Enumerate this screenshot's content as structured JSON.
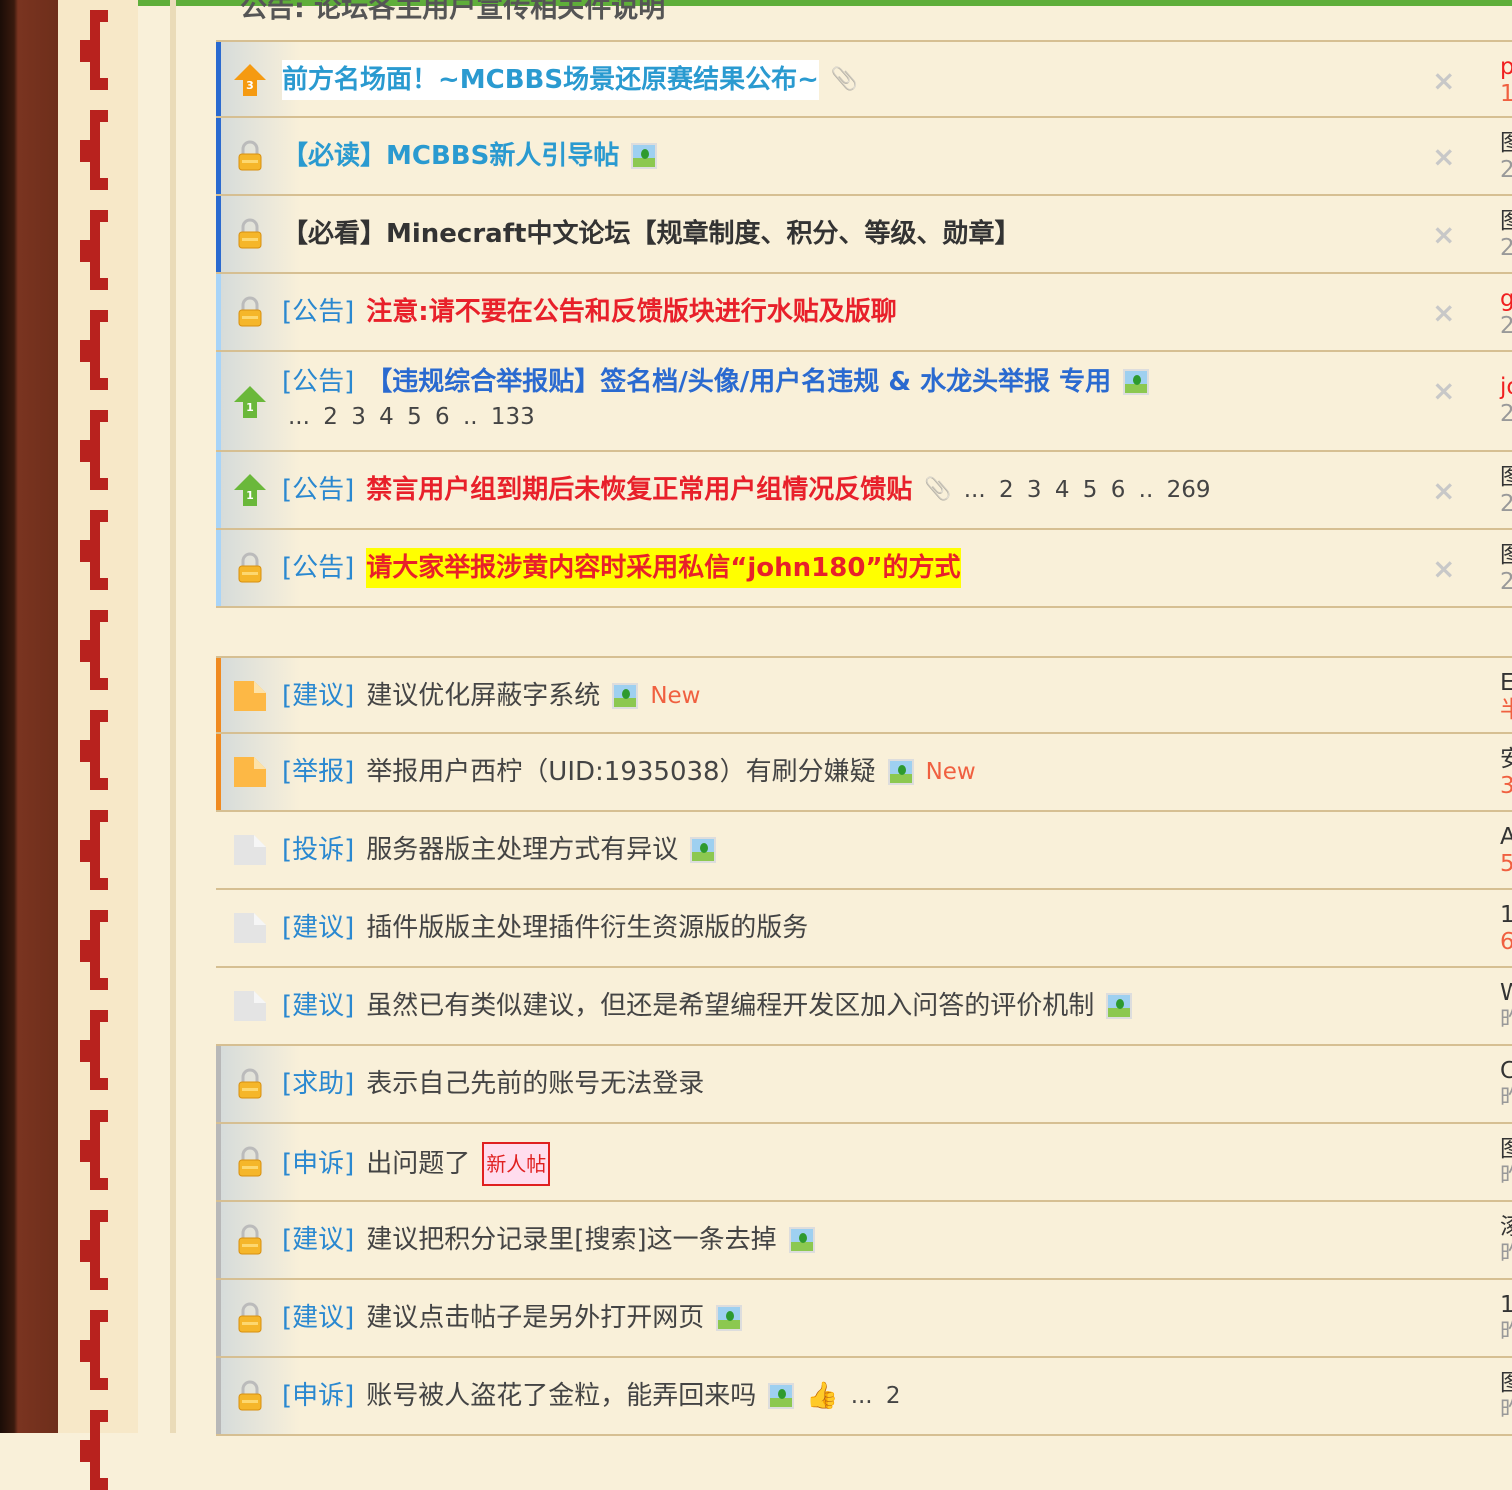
{
  "partial_title": "公告: 论坛各主用户宣传相关件说明",
  "colors": {
    "stripe_dark_blue": "#2a6ad0",
    "stripe_light_blue": "#a8d4f8",
    "stripe_orange": "#f08a20",
    "stripe_gray": "#b8b8b8",
    "top_bar": "#5fae3a"
  },
  "close_label": "×",
  "threads": [
    {
      "icon": "pin-3-icon",
      "stripe": "#2a6ad0",
      "title": "前方名场面！~MCBBS场景还原赛结果公布~",
      "style": "t-blue",
      "hl": true,
      "extras": [
        "attachment"
      ],
      "close": true,
      "author": "p",
      "date": "1",
      "author_color": "#f02020",
      "date_color": "#f06040"
    },
    {
      "icon": "lock-icon",
      "stripe": "#2a6ad0",
      "title": "【必读】MCBBS新人引导帖",
      "style": "t-blue",
      "extras": [
        "image"
      ],
      "close": true,
      "author": "图",
      "date": "2"
    },
    {
      "icon": "lock-icon",
      "stripe": "#2a6ad0",
      "title": "【必看】Minecraft中文论坛【规章制度、积分、等级、勋章】",
      "style": "t-dark",
      "extras": [],
      "close": true,
      "author": "图",
      "date": "2"
    },
    {
      "icon": "lock-icon",
      "stripe": "#a8d4f8",
      "category": "[公告]",
      "title": "注意:请不要在公告和反馈版块进行水贴及版聊",
      "style": "t-red",
      "extras": [],
      "close": true,
      "author": "g",
      "date": "2",
      "author_color": "#f02020"
    },
    {
      "icon": "pin-1-icon",
      "stripe": "#a8d4f8",
      "category": "[公告]",
      "title": "【违规综合举报贴】签名档/头像/用户名违规 & 水龙头举报 专用",
      "style": "t-dblue",
      "extras": [
        "image"
      ],
      "subpages": "... 2  3  4  5  6 .. 133",
      "close": true,
      "author": "jo",
      "date": "2",
      "author_color": "#f02020",
      "tall": true
    },
    {
      "icon": "pin-1-icon",
      "stripe": "#a8d4f8",
      "category": "[公告]",
      "title": "禁言用户组到期后未恢复正常用户组情况反馈贴",
      "style": "t-red",
      "extras": [
        "attachment"
      ],
      "pages": "... 2  3  4  5  6 .. 269",
      "close": true,
      "author": "图",
      "date": "2"
    },
    {
      "icon": "lock-icon",
      "stripe": "#a8d4f8",
      "category": "[公告]",
      "title": "请大家举报涉黄内容时采用私信“john180”的方式",
      "style": "t-hl",
      "extras": [],
      "close": true,
      "author": "图",
      "date": "2"
    }
  ],
  "normal_threads": [
    {
      "icon": "folder-new-icon",
      "stripe": "#f08a20",
      "category": "[建议]",
      "title": "建议优化屏蔽字系统",
      "style": "t-norm",
      "extras": [
        "image"
      ],
      "new_label": "New",
      "author": "E",
      "date": "半",
      "date_color": "#f06040"
    },
    {
      "icon": "folder-new-icon",
      "stripe": "#f08a20",
      "category": "[举报]",
      "title": "举报用户西柠（UID:1935038）有刷分嫌疑",
      "style": "t-norm",
      "extras": [
        "image"
      ],
      "new_label": "New",
      "author": "安",
      "date": "3",
      "date_color": "#f06040"
    },
    {
      "icon": "folder-icon",
      "category": "[投诉]",
      "title": "服务器版主处理方式有异议",
      "style": "t-norm",
      "extras": [
        "image"
      ],
      "author": "A",
      "date": "5",
      "date_color": "#f06040"
    },
    {
      "icon": "folder-icon",
      "category": "[建议]",
      "title": "插件版版主处理插件衍生资源版的版务",
      "style": "t-norm",
      "extras": [],
      "author": "1",
      "date": "6",
      "date_color": "#f06040"
    },
    {
      "icon": "folder-icon",
      "category": "[建议]",
      "title": "虽然已有类似建议，但还是希望编程开发区加入问答的评价机制",
      "style": "t-norm",
      "extras": [
        "image"
      ],
      "author": "W",
      "date": "昨"
    },
    {
      "icon": "lock-icon",
      "stripe": "#b8b8b8",
      "category": "[求助]",
      "title": "表示自己先前的账号无法登录",
      "style": "t-norm",
      "extras": [],
      "author": "C",
      "date": "昨"
    },
    {
      "icon": "lock-icon",
      "stripe": "#b8b8b8",
      "category": "[申诉]",
      "title": "出问题了",
      "style": "t-norm",
      "extras": [],
      "badge": "新人帖",
      "author": "图",
      "date": "昨"
    },
    {
      "icon": "lock-icon",
      "stripe": "#b8b8b8",
      "category": "[建议]",
      "title": "建议把积分记录里[搜索]这一条去掉",
      "style": "t-norm",
      "extras": [
        "image"
      ],
      "author": "涿",
      "date": "昨"
    },
    {
      "icon": "lock-icon",
      "stripe": "#b8b8b8",
      "category": "[建议]",
      "title": "建议点击帖子是另外打开网页",
      "style": "t-norm",
      "extras": [
        "image"
      ],
      "author": "1",
      "date": "昨"
    },
    {
      "icon": "lock-icon",
      "stripe": "#b8b8b8",
      "category": "[申诉]",
      "title": "账号被人盗花了金粒，能弄回来吗",
      "style": "t-norm",
      "extras": [
        "image",
        "thumbs-up"
      ],
      "pages": "... 2",
      "author": "图",
      "date": "昨"
    }
  ]
}
